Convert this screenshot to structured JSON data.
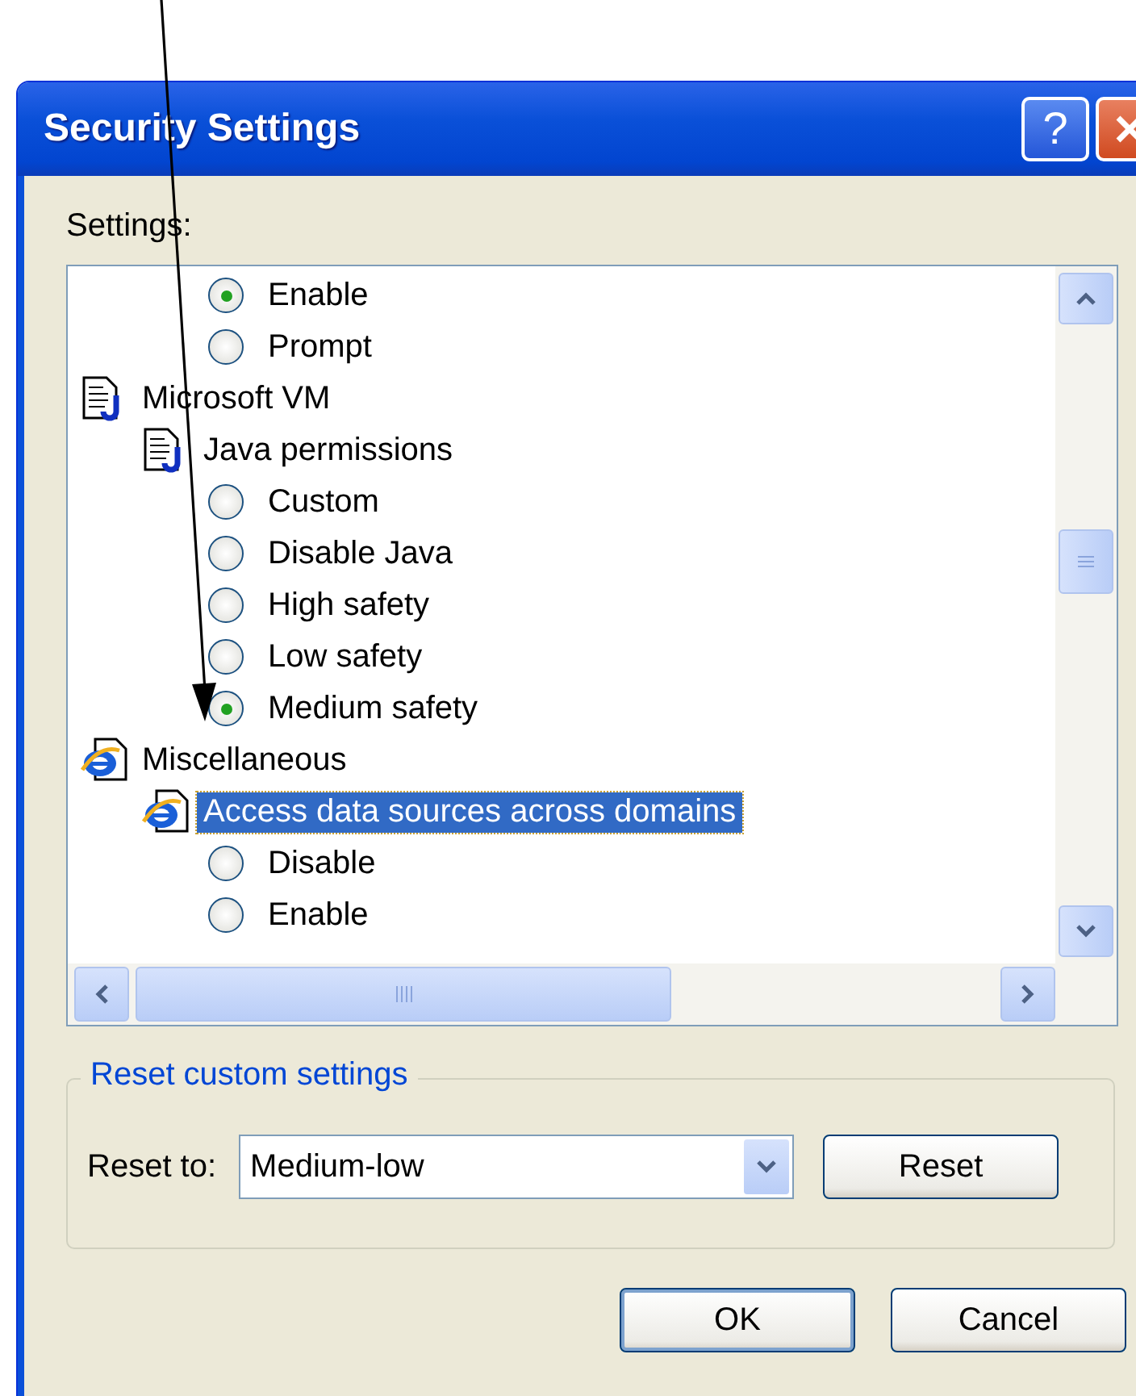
{
  "window": {
    "title": "Security Settings",
    "help_button": "?"
  },
  "settings_label": "Settings:",
  "tree": [
    {
      "kind": "radio",
      "label": "Enable",
      "checked": true
    },
    {
      "kind": "radio",
      "label": "Prompt",
      "checked": false
    },
    {
      "kind": "java-setting",
      "label": "Microsoft VM",
      "selected": false,
      "children": [
        {
          "kind": "java-setting",
          "label": "Java permissions",
          "selected": false,
          "children": [
            {
              "kind": "radio",
              "label": "Custom",
              "checked": false
            },
            {
              "kind": "radio",
              "label": "Disable Java",
              "checked": false
            },
            {
              "kind": "radio",
              "label": "High safety",
              "checked": false
            },
            {
              "kind": "radio",
              "label": "Low safety",
              "checked": false
            },
            {
              "kind": "radio",
              "label": "Medium safety",
              "checked": true
            }
          ]
        }
      ]
    },
    {
      "kind": "ie-setting",
      "label": "Miscellaneous",
      "selected": false,
      "children": [
        {
          "kind": "ie-setting",
          "label": "Access data sources across domains",
          "selected": true,
          "children": [
            {
              "kind": "radio",
              "label": "Disable",
              "checked": false
            },
            {
              "kind": "radio",
              "label": "Enable",
              "checked": false
            }
          ]
        }
      ]
    }
  ],
  "reset_group": {
    "title": "Reset custom settings",
    "label": "Reset to:",
    "value": "Medium-low",
    "button": "Reset"
  },
  "buttons": [
    "OK",
    "Cancel"
  ]
}
